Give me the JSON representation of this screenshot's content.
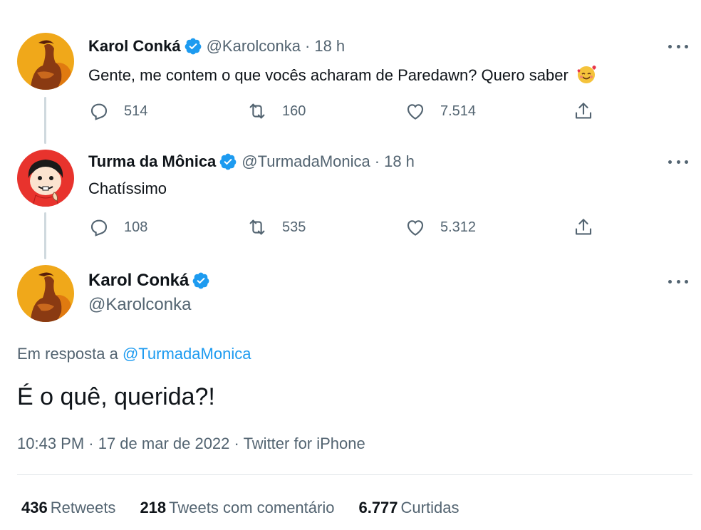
{
  "tweets": [
    {
      "name": "Karol Conká",
      "handle": "@Karolconka",
      "separator": "·",
      "time": "18 h",
      "text": "Gente, me contem o que vocês acharam de Paredawn? Quero saber",
      "emoji": "smiling-face-with-hearts-icon",
      "replies": "514",
      "retweets": "160",
      "likes": "7.514"
    },
    {
      "name": "Turma da Mônica",
      "handle": "@TurmadaMonica",
      "separator": "·",
      "time": "18 h",
      "text": "Chatíssimo",
      "replies": "108",
      "retweets": "535",
      "likes": "5.312"
    }
  ],
  "main_tweet": {
    "name": "Karol Conká",
    "handle": "@Karolconka",
    "reply_prefix": "Em resposta a",
    "reply_mention": "@TurmadaMonica",
    "text": "É o quê, querida?!",
    "timestamp": "10:43 PM · 17 de mar de 2022 · ",
    "source": "Twitter for iPhone",
    "stats": [
      {
        "count": "436",
        "label": "Retweets"
      },
      {
        "count": "218",
        "label": "Tweets com comentário"
      },
      {
        "count": "6.777",
        "label": "Curtidas"
      }
    ]
  },
  "colors": {
    "accent": "#1d9bf0",
    "secondary_text": "#536471",
    "primary_text": "#0f1419",
    "thread_line": "#cfd9de"
  }
}
